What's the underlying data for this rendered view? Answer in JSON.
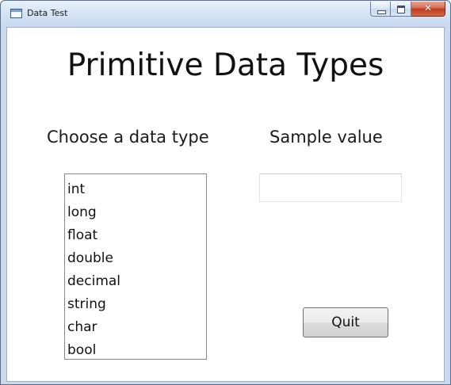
{
  "window": {
    "title": "Data Test",
    "icons": {
      "app": "app-window-icon",
      "minimize": "minimize-icon",
      "maximize": "maximize-icon",
      "close": "close-icon"
    },
    "colors": {
      "frame": "#c9d9ee",
      "close_button": "#c0391d"
    }
  },
  "main": {
    "heading": "Primitive Data Types",
    "choose_label": "Choose a data type",
    "sample_label": "Sample value",
    "data_types": [
      "int",
      "long",
      "float",
      "double",
      "decimal",
      "string",
      "char",
      "bool"
    ],
    "sample_value": "",
    "quit_label": "Quit"
  }
}
